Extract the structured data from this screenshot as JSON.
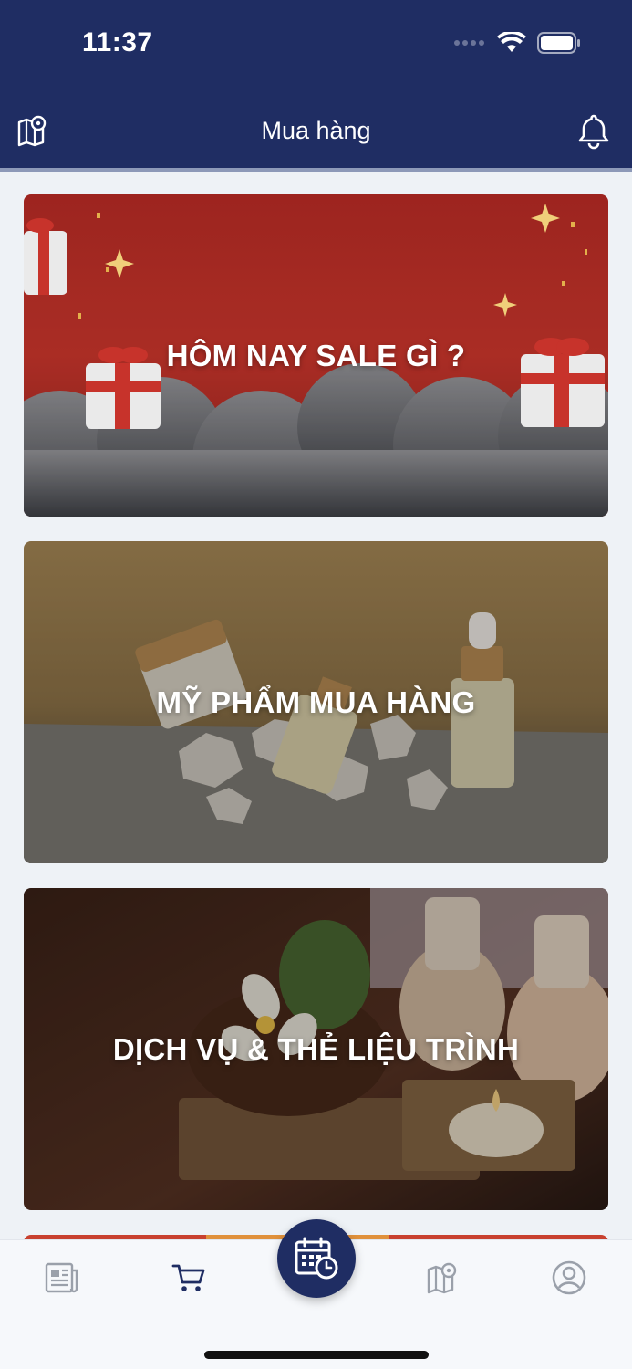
{
  "status": {
    "time": "11:37"
  },
  "header": {
    "title": "Mua hàng"
  },
  "cards": [
    {
      "label": "HÔM NAY SALE GÌ ?"
    },
    {
      "label": "MỸ PHẨM MUA HÀNG"
    },
    {
      "label": "DỊCH VỤ & THẺ LIỆU TRÌNH"
    }
  ],
  "tabs": [
    {
      "icon": "news-icon"
    },
    {
      "icon": "cart-icon",
      "active": true
    },
    {
      "icon": "calendar-clock-icon"
    },
    {
      "icon": "map-pin-icon"
    },
    {
      "icon": "user-circle-icon"
    }
  ],
  "colors": {
    "primary": "#1f2d63",
    "background": "#eef2f6",
    "inactive_icon": "#9aa0aa"
  }
}
